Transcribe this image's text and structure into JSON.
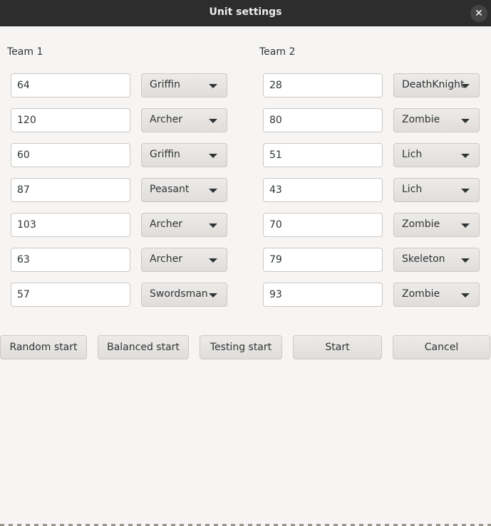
{
  "window": {
    "title": "Unit settings",
    "close_icon": "close-icon"
  },
  "team1": {
    "label": "Team 1",
    "units": [
      {
        "count": "64",
        "type": "Griffin"
      },
      {
        "count": "120",
        "type": "Archer"
      },
      {
        "count": "60",
        "type": "Griffin"
      },
      {
        "count": "87",
        "type": "Peasant"
      },
      {
        "count": "103",
        "type": "Archer"
      },
      {
        "count": "63",
        "type": "Archer"
      },
      {
        "count": "57",
        "type": "Swordsman"
      }
    ]
  },
  "team2": {
    "label": "Team 2",
    "units": [
      {
        "count": "28",
        "type": "DeathKnight"
      },
      {
        "count": "80",
        "type": "Zombie"
      },
      {
        "count": "51",
        "type": "Lich"
      },
      {
        "count": "43",
        "type": "Lich"
      },
      {
        "count": "70",
        "type": "Zombie"
      },
      {
        "count": "79",
        "type": "Skeleton"
      },
      {
        "count": "93",
        "type": "Zombie"
      }
    ]
  },
  "buttons": {
    "random_start": "Random start",
    "balanced_start": "Balanced start",
    "testing_start": "Testing start",
    "start": "Start",
    "cancel": "Cancel"
  }
}
